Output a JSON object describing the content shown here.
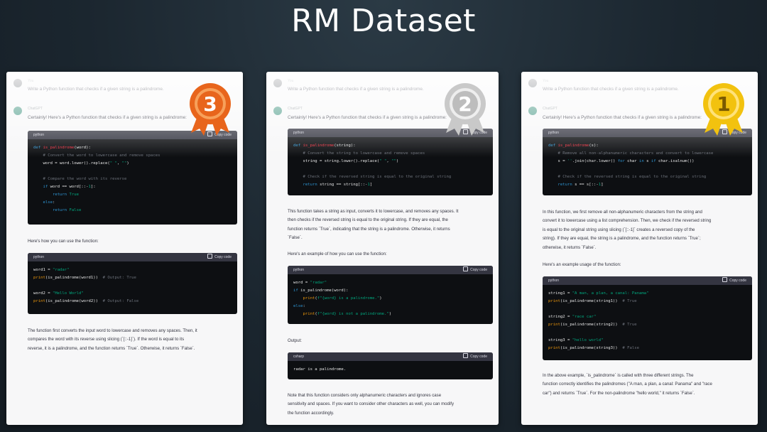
{
  "slide": {
    "title": "RM Dataset"
  },
  "cards": [
    {
      "rank": "3",
      "user_name": "You",
      "bot_name": "ChatGPT",
      "prompt": "Write a Python function that checks if a given string is a palindrome.",
      "intro": "Certainly! Here's a Python function that checks if a given string is a palindrome:",
      "code1_lang": "python",
      "code1": "def is_palindrome(word):\n    # Convert the word to lowercase and remove spaces\n    word = word.lower().replace(\" \", \"\")\n\n    # Compare the word with its reverse\n    if word == word[::-1]:\n        return True\n    else:\n        return False",
      "between": "Here's how you can use the function:",
      "code2_lang": "python",
      "code2": "word1 = \"radar\"\nprint(is_palindrome(word1))  # Output: True\n\nword2 = \"Hello World\"\nprint(is_palindrome(word2))  # Output: False",
      "para_lines": [
        "The function first converts the input word to lowercase and removes any spaces. Then, it",
        "compares the word with its reverse using slicing (`[::-1]`). If the word is equal to its",
        "reverse, it is a palindrome, and the function returns `True`. Otherwise, it returns `False`."
      ]
    },
    {
      "rank": "2",
      "user_name": "You",
      "bot_name": "ChatGPT",
      "prompt": "Write a Python function that checks if a given string is a palindrome.",
      "intro": "Certainly! Here's a Python function that checks if a given string is a palindrome:",
      "code1_lang": "python",
      "code1": "def is_palindrome(string):\n    # Convert the string to lowercase and remove spaces\n    string = string.lower().replace(\" \", \"\")\n\n    # Check if the reversed string is equal to the original string\n    return string == string[::-1]",
      "para_lines": [
        "This function takes a string as input, converts it to lowercase, and removes any spaces. It",
        "then checks if the reversed string is equal to the original string. If they are equal, the",
        "function returns `True`, indicating that the string is a palindrome. Otherwise, it returns",
        "`False`."
      ],
      "between": "Here's an example of how you can use the function:",
      "code2_lang": "python",
      "code2": "word = \"radar\"\nif is_palindrome(word):\n    print(f\"{word} is a palindrome.\")\nelse:\n    print(f\"{word} is not a palindrome.\")",
      "output_label": "Output:",
      "code3_lang": "csharp",
      "code3": "radar is a palindrome.",
      "note_lines": [
        "Note that this function considers only alphanumeric characters and ignores case",
        "sensitivity and spaces. If you want to consider other characters as well, you can modify",
        "the function accordingly."
      ]
    },
    {
      "rank": "1",
      "user_name": "You",
      "bot_name": "ChatGPT",
      "prompt": "Write a Python function that checks if a given string is a palindrome.",
      "intro": "Certainly! Here's a Python function that checks if a given string is a palindrome:",
      "code1_lang": "python",
      "code1": "def is_palindrome(s):\n    # Remove all non-alphanumeric characters and convert to lowercase\n    s = ''.join(char.lower() for char in s if char.isalnum())\n\n    # Check if the reversed string is equal to the original string\n    return s == s[::-1]",
      "para_lines": [
        "In this function, we first remove all non-alphanumeric characters from the string and",
        "convert it to lowercase using a list comprehension. Then, we check if the reversed string",
        "is equal to the original string using slicing (`[::-1]` creates a reversed copy of the",
        "string). If they are equal, the string is a palindrome, and the function returns `True`;",
        "otherwise, it returns `False`."
      ],
      "between": "Here's an example usage of the function:",
      "code2_lang": "python",
      "code2": "string1 = \"A man, a plan, a canal: Panama\"\nprint(is_palindrome(string1))  # True\n\nstring2 = \"race car\"\nprint(is_palindrome(string2))  # True\n\nstring3 = \"hello world\"\nprint(is_palindrome(string3))  # False",
      "final_lines": [
        "In the above example, `is_palindrome` is called with three different strings. The",
        "function correctly identifies the palindromes (\"A man, a plan, a canal: Panama\" and \"race",
        "car\") and returns `True`. For the non-palindrome \"hello world,\" it returns `False`."
      ]
    }
  ],
  "copy_label": "Copy code",
  "colors": {
    "bronze": "#e8651c",
    "silver": "#c9c9c9",
    "gold": "#f2c20f"
  }
}
